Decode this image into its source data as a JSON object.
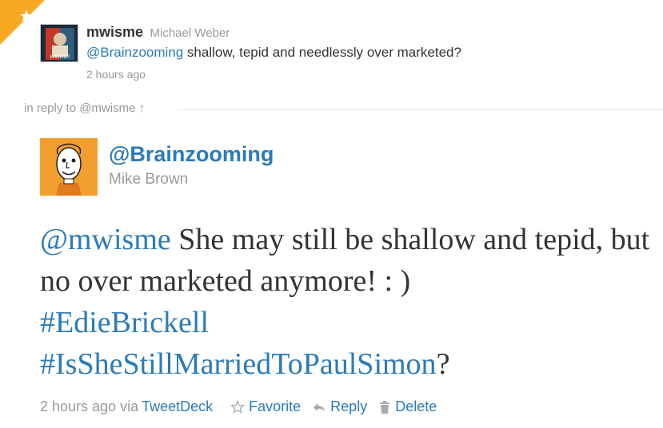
{
  "parent": {
    "username": "mwisme",
    "fullname": "Michael Weber",
    "mention": "@Brainzooming",
    "text": " shallow, tepid and needlessly over marketed?",
    "time": "2 hours ago",
    "avatar_label": "WWWD?"
  },
  "in_reply_to": {
    "label": "in reply to @mwisme",
    "arrow": "↑"
  },
  "main": {
    "username": "@Brainzooming",
    "fullname": "Mike Brown",
    "mention": "@mwisme",
    "text1": " She may still be shallow and tepid, but no over marketed anymore! : )",
    "hashtag1": "#EdieBrickell",
    "hashtag2": "#IsSheStillMarriedToPaulSimon",
    "qmark": "?"
  },
  "footer": {
    "time": "2 hours ago via ",
    "client": "TweetDeck",
    "favorite": "Favorite",
    "reply": "Reply",
    "delete": "Delete"
  },
  "colors": {
    "link": "#2b7bb9",
    "text": "#333333",
    "muted": "#999999",
    "corner": "#f7a823"
  }
}
